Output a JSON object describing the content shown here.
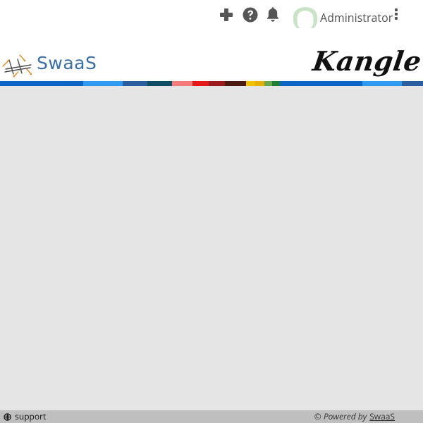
{
  "header": {
    "icons": [
      "plus-icon",
      "question-circle-icon",
      "bell-icon"
    ],
    "username": "Administrator",
    "menu_icon": "vertical-dots-icon"
  },
  "brand": {
    "left_logo_text": "SwaaS",
    "right_logo_text": "Kangle"
  },
  "colors": {
    "stripe": [
      "#0a66c2",
      "#2e9bf0",
      "#2d5fa0",
      "#0e4c66",
      "#f47c7c",
      "#e41b17",
      "#9b1c1c",
      "#4b1b12",
      "#f2c200",
      "#e8b000",
      "#6aa84f",
      "#1d7f35"
    ],
    "main_bg": "#e5e5e5",
    "footer_bg": "#bfbfbf"
  },
  "footer": {
    "support_label": "support",
    "powered_by_label": "© Powered by",
    "powered_by_link": "SwaaS"
  }
}
